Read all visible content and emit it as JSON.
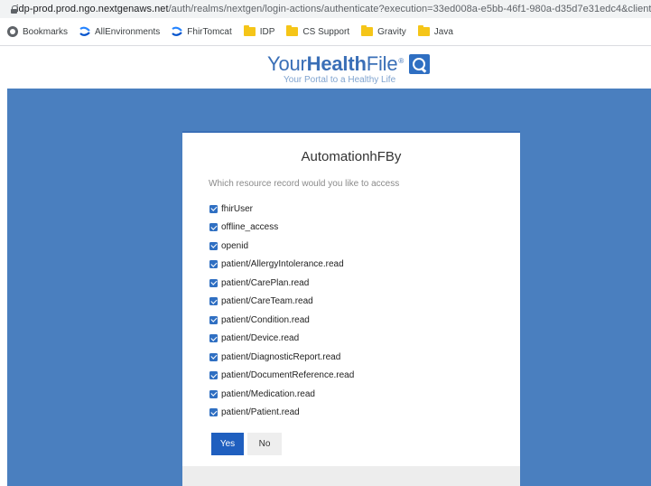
{
  "browser": {
    "url_host": "idp-prod.prod.ngo.nextgenaws.net",
    "url_path": "/auth/realms/nextgen/login-actions/authenticate?execution=33ed008a-e5bb-46f1-980a-d35d7e31edc4&client_i",
    "bookmarks": [
      {
        "label": "Bookmarks",
        "icon": "bookmarks-icon"
      },
      {
        "label": "AllEnvironments",
        "icon": "confluence-icon"
      },
      {
        "label": "FhirTomcat",
        "icon": "confluence-icon"
      },
      {
        "label": "IDP",
        "icon": "folder-icon"
      },
      {
        "label": "CS Support",
        "icon": "folder-icon"
      },
      {
        "label": "Gravity",
        "icon": "folder-icon"
      },
      {
        "label": "Java",
        "icon": "folder-icon"
      }
    ]
  },
  "header": {
    "logo_prefix": "Your",
    "logo_bold": "Health",
    "logo_suffix": "File",
    "logo_reg": "®",
    "tagline": "Your Portal to a Healthy Life"
  },
  "card": {
    "title": "AutomationhFBy",
    "question": "Which resource record would you like to access",
    "scopes": [
      {
        "label": "fhirUser",
        "checked": true
      },
      {
        "label": "offline_access",
        "checked": true
      },
      {
        "label": "openid",
        "checked": true
      },
      {
        "label": "patient/AllergyIntolerance.read",
        "checked": true
      },
      {
        "label": "patient/CarePlan.read",
        "checked": true
      },
      {
        "label": "patient/CareTeam.read",
        "checked": true
      },
      {
        "label": "patient/Condition.read",
        "checked": true
      },
      {
        "label": "patient/Device.read",
        "checked": true
      },
      {
        "label": "patient/DiagnosticReport.read",
        "checked": true
      },
      {
        "label": "patient/DocumentReference.read",
        "checked": true
      },
      {
        "label": "patient/Medication.read",
        "checked": true
      },
      {
        "label": "patient/Patient.read",
        "checked": true
      }
    ],
    "yes_label": "Yes",
    "no_label": "No"
  },
  "colors": {
    "brand_blue": "#3a6fb7",
    "background_blue": "#4a7fbf",
    "button_blue": "#1f5fbf"
  }
}
